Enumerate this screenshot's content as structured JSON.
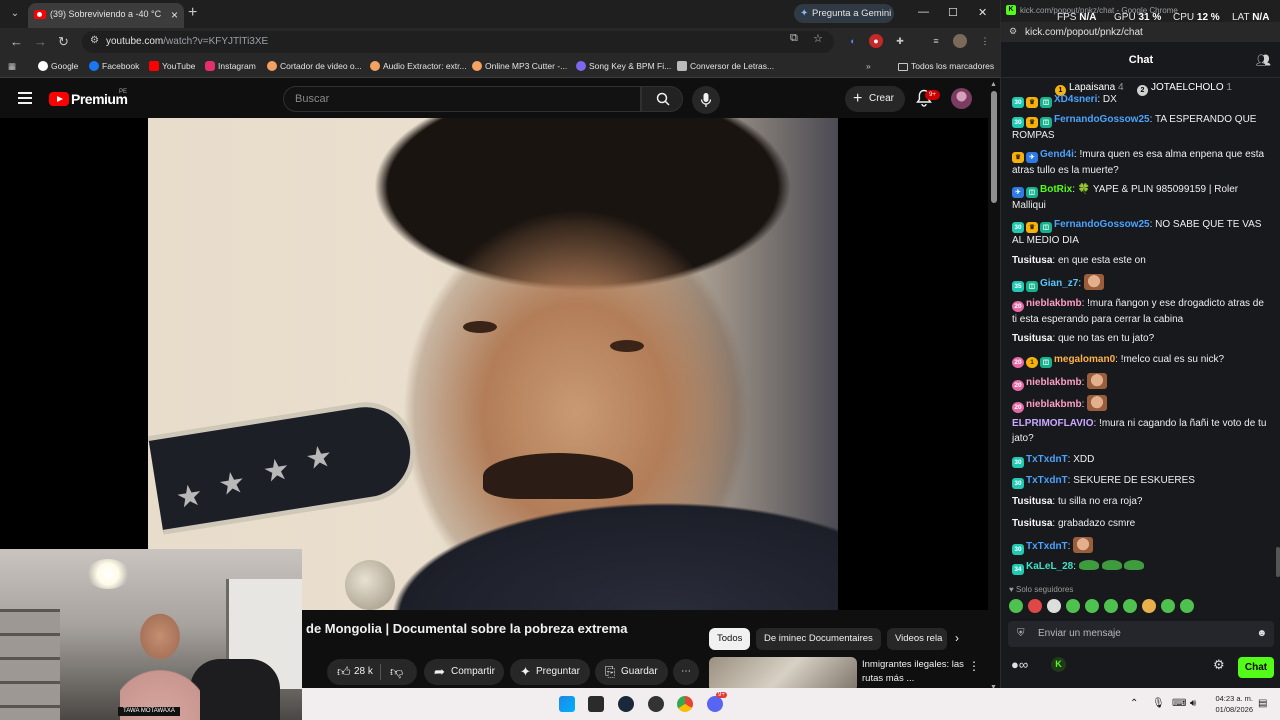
{
  "browser": {
    "tab_title": "(39) Sobreviviendo a -40 °C",
    "gemini_label": "Pregunta a Gemini",
    "url_host": "youtube.com",
    "url_path": "/watch?v=KFYJTlTi3XE",
    "bookmarks": [
      "Google",
      "Facebook",
      "YouTube",
      "Instagram",
      "Cortador de video o...",
      "Audio Extractor: extr...",
      "Online MP3 Cutter -...",
      "Song Key & BPM Fi...",
      "Conversor de Letras..."
    ],
    "all_bookmarks": "Todos los marcadores"
  },
  "youtube": {
    "brand": "Premium",
    "country": "PE",
    "search_placeholder": "Buscar",
    "create_label": "Crear",
    "notif_badge": "9+",
    "video_title": "de Mongolia | Documental sobre la pobreza extrema",
    "chips": [
      "Todos",
      "De iminec Documentaires",
      "Videos rela"
    ],
    "likes": "28 k",
    "share_label": "Compartir",
    "ask_label": "Preguntar",
    "save_label": "Guardar",
    "rec_title": "Inmigrantes ilegales: las rutas más ...",
    "cam_tag": "TAWA MOTAWAXA"
  },
  "chat_window": {
    "window_title": "kick.com/popout/pnkz/chat - Google Chrome",
    "hud": {
      "fps_label": "FPS",
      "fps": "N/A",
      "gpu_label": "GPU",
      "gpu": "31 %",
      "cpu_label": "CPU",
      "cpu": "12 %",
      "lat_label": "LAT",
      "lat": "N/A"
    },
    "url": "kick.com/popout/pnkz/chat",
    "header": "Chat",
    "pinned": [
      {
        "name": "Lapaisana",
        "count": "4"
      },
      {
        "name": "JOTAELCHOLO",
        "count": "1"
      }
    ],
    "messages": [
      {
        "user": "XD4sneri",
        "text": "DX"
      },
      {
        "user": "FernandoGossow25",
        "text": "TA ESPERANDO QUE ROMPAS"
      },
      {
        "user": "Gend4i",
        "text": "!mura quen es esa alma enpena que esta atras tullo es la muerte?"
      },
      {
        "user": "BotRix",
        "text": "🍀 YAPE & PLIN 985099159 | Roler Malliqui"
      },
      {
        "user": "FernandoGossow25",
        "text": "NO SABE QUE TE VAS AL MEDIO DIA"
      },
      {
        "user": "Tusitusa",
        "text": "en que esta este on"
      },
      {
        "user": "Gian_z7",
        "text": ""
      },
      {
        "user": "nieblakbmb",
        "text": "!mura ñangon y ese drogadicto atras de ti esta esperando para cerrar la cabina"
      },
      {
        "user": "Tusitusa",
        "text": "que no tas en tu jato?"
      },
      {
        "user": "megaloman0",
        "text": "!melco cual es su nick?"
      },
      {
        "user": "nieblakbmb",
        "text": ""
      },
      {
        "user": "nieblakbmb",
        "text": ""
      },
      {
        "user": "ELPRIMOFLAVIO",
        "text": "!mura ni cagando la ñañi te voto de tu jato?"
      },
      {
        "user": "TxTxdnT",
        "text": "XDD"
      },
      {
        "user": "TxTxdnT",
        "text": "SEKUERE DE ESKUERES"
      },
      {
        "user": "Tusitusa",
        "text": "tu silla no era roja?"
      },
      {
        "user": "Tusitusa",
        "text": "grabadazo csmre"
      },
      {
        "user": "TxTxdnT",
        "text": ""
      },
      {
        "user": "KaLeL_28",
        "text": ""
      }
    ],
    "badges": {
      "sub30": "30",
      "sub20": "20",
      "sub35": "35",
      "sub34": "34",
      "gold1": "1",
      "pin2": "2"
    },
    "followers_only": "Solo seguidores",
    "input_placeholder": "Enviar un mensaje",
    "send_label": "Chat"
  },
  "taskbar": {
    "time": "04:23 a. m.",
    "date": "01/08/2026",
    "discord_badge": "9+"
  },
  "colors": {
    "kick_green": "#53fc18",
    "youtube_red": "#ff0000",
    "chrome_dark": "#1f1f1f"
  }
}
